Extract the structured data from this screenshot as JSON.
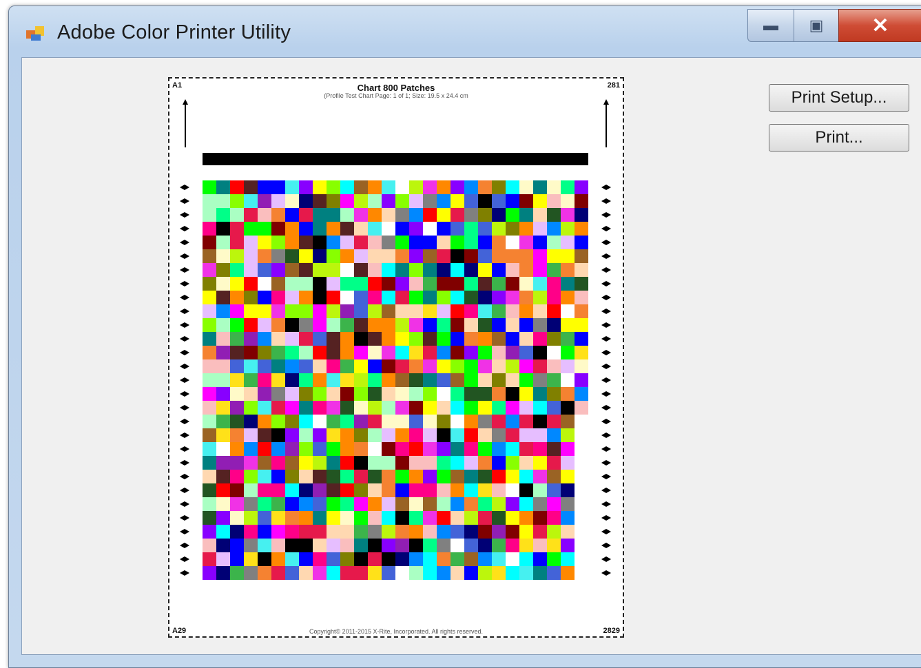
{
  "window": {
    "title": "Adobe Color Printer Utility",
    "controls": {
      "minimize_icon": "minimize-icon",
      "maximize_icon": "maximize-icon",
      "close_icon": "close-icon"
    }
  },
  "chart_page": {
    "title": "Chart 800 Patches",
    "subtitle": "(Profile Test Chart Page: 1 of 1; Size: 19.5 x 24.4 cm",
    "copyright": "Copyright© 2011-2015 X-Rite, Incorporated. All rights reserved.",
    "corners": {
      "top_left": "A1",
      "top_right": "281",
      "bottom_left": "A29",
      "bottom_right": "2829"
    }
  },
  "patches": {
    "columns": 28,
    "full_rows": 17,
    "partial_rows": 12,
    "palette": [
      "#e6194b",
      "#3cb44b",
      "#ffe119",
      "#4363d8",
      "#f58231",
      "#911eb4",
      "#46f0f0",
      "#f032e6",
      "#bcf60c",
      "#fabebe",
      "#008080",
      "#e6beff",
      "#9a6324",
      "#fffac8",
      "#800000",
      "#aaffc3",
      "#808000",
      "#ffd8b1",
      "#000075",
      "#808080",
      "#ffffff",
      "#000000",
      "#ff0000",
      "#00ff00",
      "#0000ff",
      "#ffff00",
      "#00ffff",
      "#ff00ff",
      "#ff8800",
      "#88ff00",
      "#0088ff",
      "#8800ff",
      "#ff0088",
      "#00ff88",
      "#225522",
      "#552222"
    ]
  },
  "buttons": {
    "print_setup": "Print Setup...",
    "print": "Print..."
  }
}
